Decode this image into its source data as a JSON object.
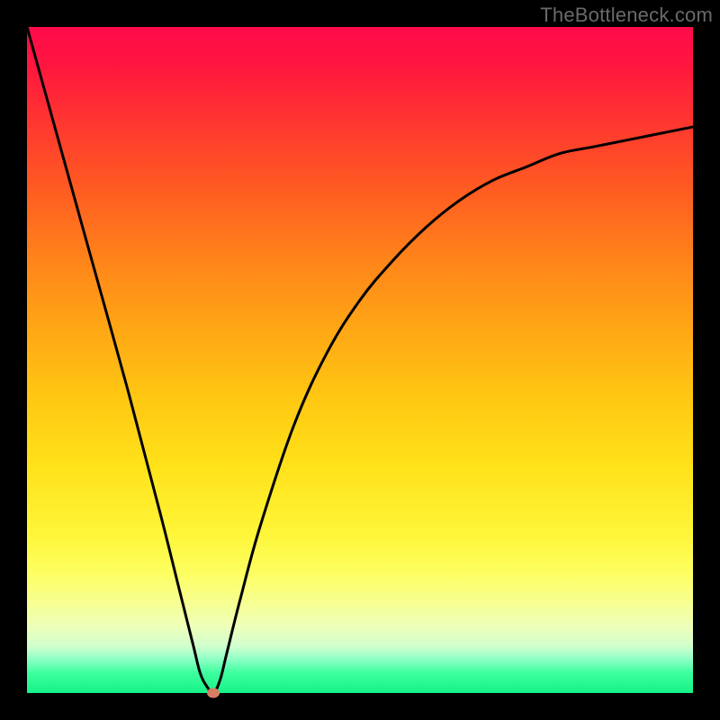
{
  "watermark": "TheBottleneck.com",
  "colors": {
    "frame": "#000000",
    "curve": "#000000",
    "dot": "#d67e64",
    "gradient_top": "#ff0a4a",
    "gradient_bottom": "#17f288"
  },
  "chart_data": {
    "type": "line",
    "title": "",
    "xlabel": "",
    "ylabel": "",
    "xlim": [
      0,
      100
    ],
    "ylim": [
      0,
      100
    ],
    "grid": false,
    "legend": false,
    "series": [
      {
        "name": "bottleneck-curve",
        "x": [
          0,
          5,
          10,
          15,
          20,
          23,
          25,
          26,
          27,
          28,
          29,
          30,
          32,
          35,
          40,
          45,
          50,
          55,
          60,
          65,
          70,
          75,
          80,
          85,
          90,
          95,
          100
        ],
        "values": [
          100,
          82,
          64,
          46,
          27,
          15,
          7,
          3,
          1,
          0,
          2,
          6,
          14,
          25,
          40,
          51,
          59,
          65,
          70,
          74,
          77,
          79,
          81,
          82,
          83,
          84,
          85
        ]
      }
    ],
    "minimum_point": {
      "x": 28,
      "y": 0
    }
  }
}
